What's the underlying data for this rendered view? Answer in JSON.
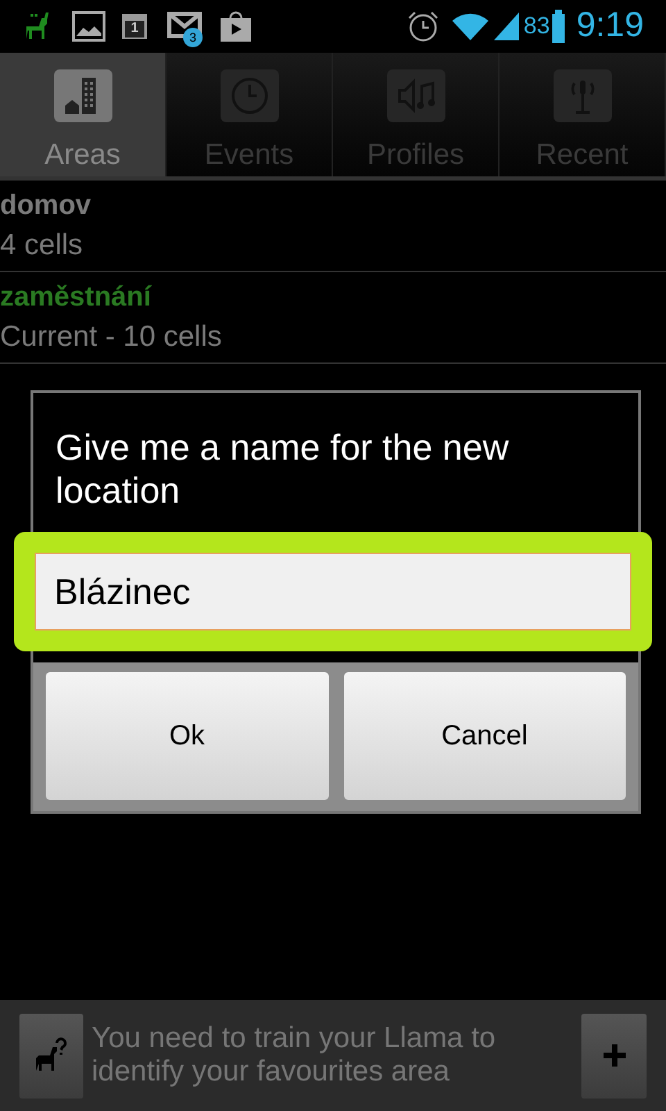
{
  "status_bar": {
    "calendar_day": "1",
    "mail_count": "3",
    "battery": "83",
    "time": "9:19"
  },
  "tabs": [
    {
      "label": "Areas",
      "selected": true
    },
    {
      "label": "Events",
      "selected": false
    },
    {
      "label": "Profiles",
      "selected": false
    },
    {
      "label": "Recent",
      "selected": false
    }
  ],
  "areas": [
    {
      "name": "domov",
      "detail": "4 cells",
      "current": false
    },
    {
      "name": "zaměstnání",
      "detail": "Current - 10 cells",
      "current": true
    }
  ],
  "dialog": {
    "title": "Give me a name for the new location",
    "value": "Blázinec",
    "focused": true,
    "buttons": [
      "Ok",
      "Cancel"
    ]
  },
  "footer": {
    "hint": "You need to train your Llama to identify your favourites area"
  }
}
